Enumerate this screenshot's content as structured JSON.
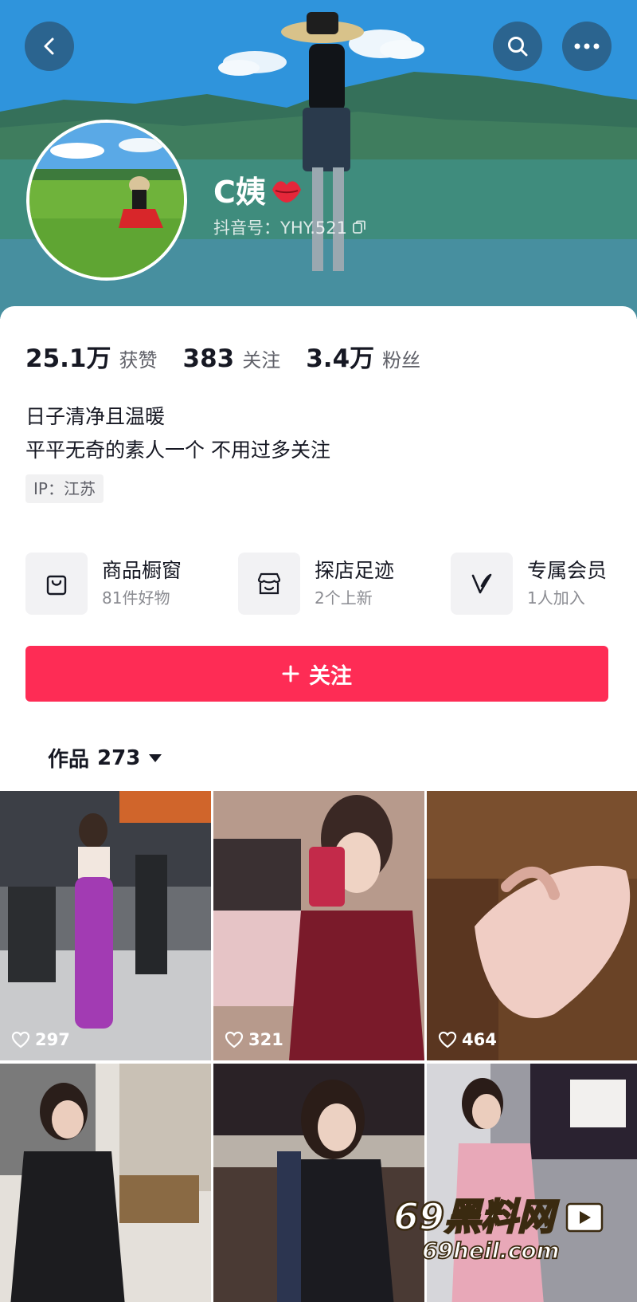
{
  "header": {
    "nickname": "C姨",
    "douyin_id": "抖音号：YHY.521",
    "icons": [
      "back-icon",
      "search-icon",
      "more-icon",
      "lips-icon",
      "copy-icon"
    ]
  },
  "stats": [
    {
      "value": "25.1万",
      "label": "获赞"
    },
    {
      "value": "383",
      "label": "关注"
    },
    {
      "value": "3.4万",
      "label": "粉丝"
    }
  ],
  "bio": {
    "line1": "日子清净且温暖",
    "line2": "平平无奇的素人一个 不用过多关注",
    "ip": "IP：江苏"
  },
  "features": [
    {
      "title": "商品橱窗",
      "subtitle": "81件好物",
      "icon": "bag-icon"
    },
    {
      "title": "探店足迹",
      "subtitle": "2个上新",
      "icon": "shop-icon"
    },
    {
      "title": "专属会员",
      "subtitle": "1人加入",
      "icon": "vip-v-icon"
    }
  ],
  "follow_button": {
    "label": "关注",
    "icon": "plus-icon"
  },
  "works_tab": {
    "label": "作品",
    "count": "273"
  },
  "videos": [
    {
      "likes": "297"
    },
    {
      "likes": "321"
    },
    {
      "likes": "464"
    },
    {
      "likes": ""
    },
    {
      "likes": ""
    },
    {
      "likes": ""
    }
  ],
  "watermark": {
    "line1": "69黑料网",
    "line2": "69heil.com"
  },
  "colors": {
    "accent": "#fe2c55",
    "text": "#161823",
    "secondary": "#5f6068"
  }
}
